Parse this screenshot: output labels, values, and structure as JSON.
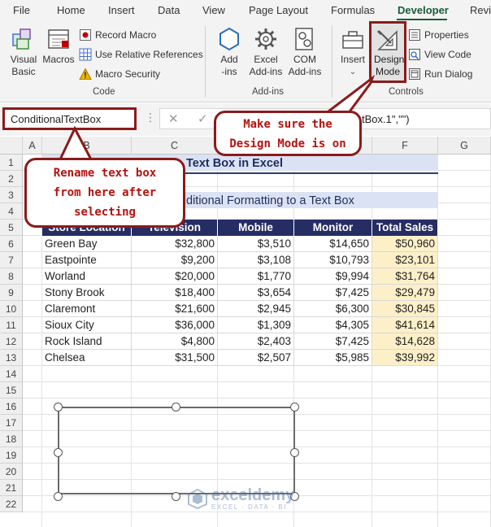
{
  "menu": {
    "tabs": [
      {
        "label": "File",
        "active": false
      },
      {
        "label": "Home",
        "active": false
      },
      {
        "label": "Insert",
        "active": false
      },
      {
        "label": "Data",
        "active": false
      },
      {
        "label": "View",
        "active": false
      },
      {
        "label": "Page Layout",
        "active": false
      },
      {
        "label": "Formulas",
        "active": false
      },
      {
        "label": "Developer",
        "active": true
      },
      {
        "label": "Revi",
        "active": false
      }
    ]
  },
  "ribbon": {
    "code": {
      "visual_basic": "Visual Basic",
      "macros": "Macros",
      "record_macro": "Record Macro",
      "relative_refs": "Use Relative References",
      "macro_security": "Macro Security",
      "group_label": "Code"
    },
    "addins": {
      "addins": "Add-ins",
      "excel_addins": "Excel Add-ins",
      "com_addins": "COM Add-ins",
      "group_label": "Add-ins"
    },
    "controls": {
      "insert": "Insert",
      "design_mode": "Design Mode",
      "properties": "Properties",
      "view_code": "View Code",
      "run_dialog": "Run Dialog",
      "group_label": "Controls"
    }
  },
  "formula_bar": {
    "name_box": "ConditionalTextBox",
    "formula_fragment": "tBox.1\",\"\")"
  },
  "grid": {
    "columns": [
      "A",
      "B",
      "C",
      "D",
      "E",
      "F",
      "G"
    ],
    "rows": [
      "1",
      "2",
      "3",
      "4",
      "5",
      "6",
      "7",
      "8",
      "9",
      "10",
      "11",
      "12",
      "13",
      "14",
      "15",
      "16",
      "17",
      "18",
      "19",
      "20",
      "21",
      "22"
    ],
    "title": "Text Box in Excel",
    "subtitle": "ditional Formatting to a Text Box",
    "table": {
      "headers": [
        "Store Location",
        "Television",
        "Mobile",
        "Monitor",
        "Total Sales"
      ],
      "rows": [
        [
          "Green Bay",
          "$32,800",
          "$3,510",
          "$14,650",
          "$50,960"
        ],
        [
          "Eastpointe",
          "$9,200",
          "$3,108",
          "$10,793",
          "$23,101"
        ],
        [
          "Worland",
          "$20,000",
          "$1,770",
          "$9,994",
          "$31,764"
        ],
        [
          "Stony Brook",
          "$18,400",
          "$3,654",
          "$7,425",
          "$29,479"
        ],
        [
          "Claremont",
          "$21,600",
          "$2,945",
          "$6,300",
          "$30,845"
        ],
        [
          "Sioux City",
          "$36,000",
          "$1,309",
          "$4,305",
          "$41,614"
        ],
        [
          "Rock Island",
          "$4,800",
          "$2,403",
          "$7,425",
          "$14,628"
        ],
        [
          "Chelsea",
          "$31,500",
          "$2,507",
          "$5,985",
          "$39,992"
        ]
      ]
    }
  },
  "callouts": {
    "design_mode": [
      "Make sure the",
      "Design Mode is on"
    ],
    "rename": [
      "Rename text box",
      "from here after",
      "selecting"
    ]
  },
  "watermark": {
    "name": "exceldemy",
    "tagline": "EXCEL · DATA · BI"
  },
  "colors": {
    "accent_dark_red": "#8b1a1a",
    "callout_text": "#b3120f",
    "table_header": "#262d63",
    "total_fill": "#fdf0c8",
    "developer_tab": "#185c37"
  }
}
